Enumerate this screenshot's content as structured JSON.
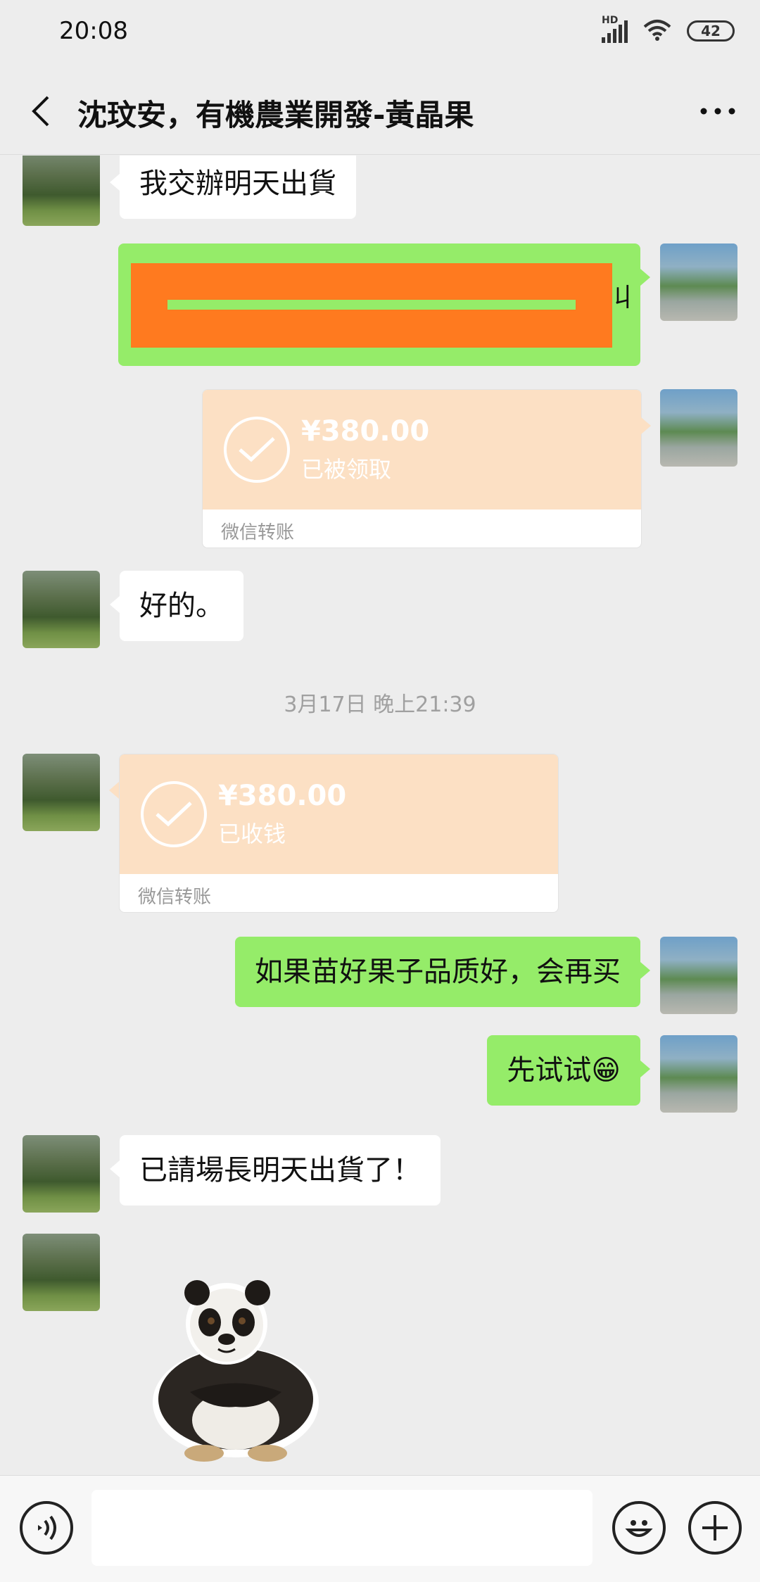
{
  "status_bar": {
    "time": "20:08",
    "signal_label": "HD",
    "battery": "42"
  },
  "header": {
    "title": "沈玟安，有機農業開發-黃晶果",
    "back_icon": "chevron-left-icon",
    "more_icon": "more-dots-icon"
  },
  "messages": [
    {
      "side": "in",
      "type": "text",
      "text": "我交辦明天出貨"
    },
    {
      "side": "out",
      "type": "redacted",
      "text": "",
      "visible_tail": "丩"
    },
    {
      "side": "out",
      "type": "transfer",
      "amount": "¥380.00",
      "status": "已被领取",
      "label": "微信转账"
    },
    {
      "side": "in",
      "type": "text",
      "text": "好的。"
    },
    {
      "type": "timestamp",
      "text": "3月17日 晚上21:39"
    },
    {
      "side": "in",
      "type": "transfer",
      "amount": "¥380.00",
      "status": "已收钱",
      "label": "微信转账"
    },
    {
      "side": "out",
      "type": "text",
      "text": "如果苗好果子品质好，会再买"
    },
    {
      "side": "out",
      "type": "text",
      "text": "先试试😁"
    },
    {
      "side": "in",
      "type": "text",
      "text": "已請場長明天出貨了！"
    },
    {
      "side": "in",
      "type": "sticker",
      "icon": "panda-sticker-icon"
    }
  ],
  "input_bar": {
    "voice_icon": "voice-icon",
    "emoji_icon": "emoji-icon",
    "plus_icon": "plus-icon",
    "placeholder": ""
  },
  "colors": {
    "background": "#ededed",
    "outgoing_bubble": "#95ec69",
    "incoming_bubble": "#ffffff",
    "transfer_card": "#fce0c4",
    "redaction_fill": "#ff7a1f",
    "redaction_line": "#95ec69"
  }
}
